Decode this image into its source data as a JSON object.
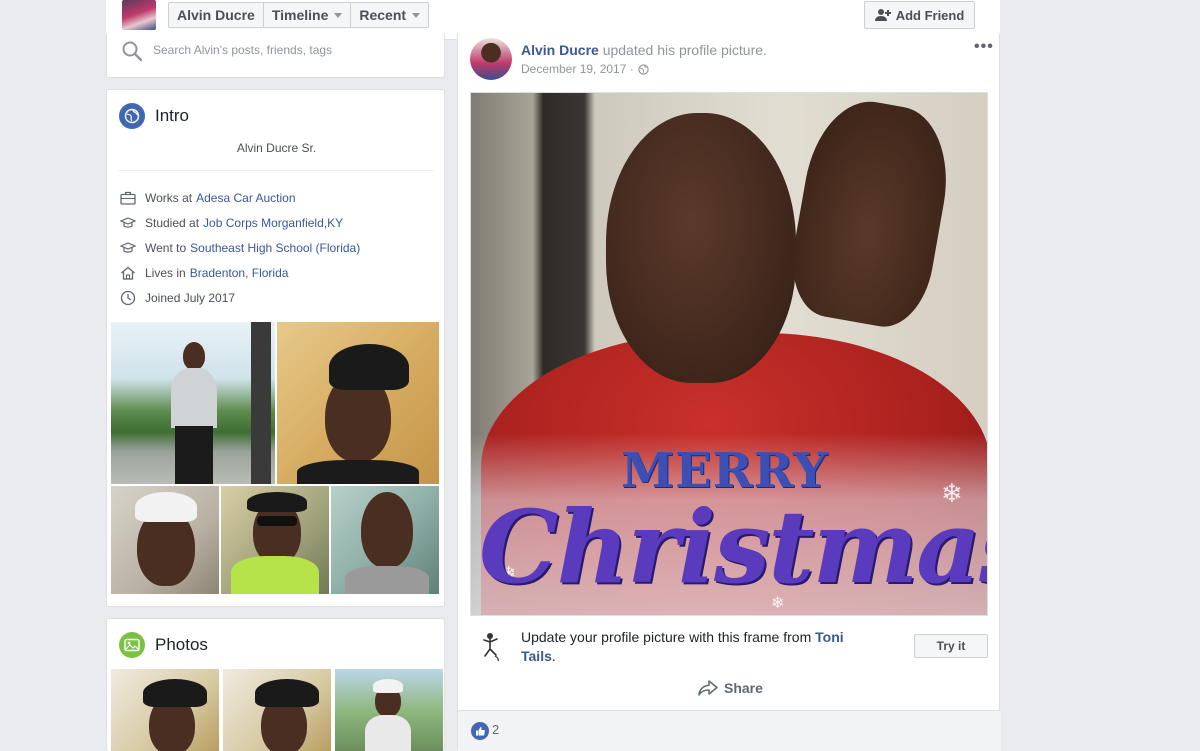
{
  "topnav": {
    "profile_name": "Alvin Ducre",
    "timeline": "Timeline",
    "recent": "Recent",
    "add_friend": "Add Friend"
  },
  "search": {
    "placeholder": "Search Alvin's posts, friends, tags"
  },
  "intro": {
    "title": "Intro",
    "bio": "Alvin Ducre Sr.",
    "items": [
      {
        "prefix": "Works at",
        "link": "Adesa Car Auction",
        "icon": "briefcase-icon"
      },
      {
        "prefix": "Studied at",
        "link": "Job Corps Morganfield,KY",
        "icon": "graduation-cap-icon"
      },
      {
        "prefix": "Went to",
        "link": "Southeast High School (Florida)",
        "icon": "graduation-cap-icon"
      },
      {
        "prefix": "Lives in",
        "link": "Bradenton, Florida",
        "icon": "home-icon"
      },
      {
        "prefix": "Joined July 2017",
        "link": "",
        "icon": "clock-icon"
      }
    ]
  },
  "photos": {
    "title": "Photos"
  },
  "post": {
    "author": "Alvin Ducre",
    "action": " updated his profile picture.",
    "date": "December 19, 2017 ·",
    "image_text_top": "MERRY",
    "image_text_bottom": "Christmas",
    "frame_prefix": "Update your profile picture with this frame from ",
    "frame_author": "Toni Tails",
    "frame_suffix": ".",
    "try_it": "Try it",
    "share": "Share",
    "like_count": "2"
  },
  "colors": {
    "link": "#385898",
    "brand": "#4267b2",
    "background": "#e9ebee"
  }
}
